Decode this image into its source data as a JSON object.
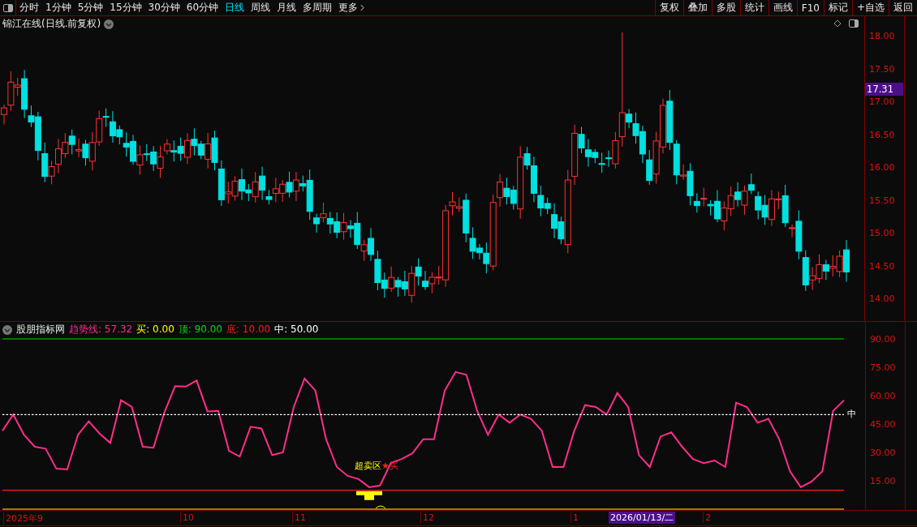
{
  "toolbar": {
    "periods": [
      {
        "label": "分时",
        "selected": false
      },
      {
        "label": "1分钟",
        "selected": false
      },
      {
        "label": "5分钟",
        "selected": false
      },
      {
        "label": "15分钟",
        "selected": false
      },
      {
        "label": "30分钟",
        "selected": false
      },
      {
        "label": "60分钟",
        "selected": false
      },
      {
        "label": "日线",
        "selected": true
      },
      {
        "label": "周线",
        "selected": false
      },
      {
        "label": "月线",
        "selected": false
      },
      {
        "label": "多周期",
        "selected": false
      },
      {
        "label": "更多",
        "selected": false
      }
    ],
    "actions": [
      "复权",
      "叠加",
      "多股",
      "统计",
      "画线",
      "F10",
      "标记",
      "+自选",
      "返回"
    ]
  },
  "main_chart": {
    "title": "锦江在线(日线.前复权)",
    "price_ticks": [
      "18.00",
      "17.50",
      "17.00",
      "16.50",
      "16.00",
      "15.50",
      "15.00",
      "14.50",
      "14.00"
    ],
    "current_price": "17.31"
  },
  "indicator": {
    "name": "股朋指标网",
    "readouts": [
      {
        "label": "趋势线:",
        "value": "57.32",
        "color": "#ff2d8a"
      },
      {
        "label": "买:",
        "value": "0.00",
        "color": "#ffff00"
      },
      {
        "label": "顶:",
        "value": "90.00",
        "color": "#00dd00"
      },
      {
        "label": "底:",
        "value": "10.00",
        "color": "#ff1a1a"
      },
      {
        "label": "中:",
        "value": "50.00",
        "color": "#ffffff"
      }
    ],
    "mid_label": "中",
    "zone_label": "超卖区",
    "signal_label": "★买",
    "chart_data": {
      "type": "line",
      "ylim": [
        0,
        99
      ],
      "yticks": [
        {
          "value": 90,
          "label": "90.00"
        },
        {
          "value": 75,
          "label": "75.00"
        },
        {
          "value": 60,
          "label": "60.00"
        },
        {
          "value": 45,
          "label": "45.00"
        },
        {
          "value": 30,
          "label": "30.00"
        },
        {
          "value": 15,
          "label": "15.00"
        }
      ],
      "series": [
        {
          "color": "#ff2d8a",
          "values": [
            41.4,
            50,
            39.3,
            33,
            32,
            21.4,
            21,
            39.3,
            46.5,
            40,
            35,
            57.6,
            54,
            33,
            32.5,
            51,
            65,
            64.8,
            68,
            51.7,
            52,
            30.8,
            27.8,
            43.6,
            42.7,
            28.6,
            30,
            54,
            69,
            62.7,
            37,
            22.3,
            17.6,
            15.9,
            11.6,
            12.5,
            24.4,
            26.5,
            29.5,
            37,
            37,
            62.7,
            72.5,
            71,
            52,
            39.3,
            50,
            45.7,
            50,
            47.8,
            41.4,
            22.3,
            22.3,
            41.4,
            55,
            54,
            50,
            61.4,
            54,
            28.6,
            22.3,
            38.4,
            40.6,
            33,
            26.5,
            24.4,
            25.7,
            22.3,
            56.3,
            54,
            45.7,
            47.8,
            37,
            20,
            11.6,
            14.6,
            20,
            52,
            57.6
          ]
        },
        {
          "color": "#ffff00",
          "values": [
            0,
            0,
            0,
            0,
            0,
            0,
            0,
            0,
            0,
            0,
            0,
            0,
            0,
            0,
            0,
            0,
            0,
            0,
            0,
            0,
            0,
            0,
            0,
            0,
            0,
            0,
            0,
            0,
            0,
            0,
            0,
            0,
            0,
            0,
            0,
            0,
            0,
            0,
            0,
            0,
            0,
            0,
            0,
            0,
            0,
            0,
            0,
            0,
            0,
            0,
            0,
            0,
            0,
            0,
            0,
            0,
            0,
            0,
            0,
            0,
            0,
            0,
            0,
            0,
            0,
            0,
            0,
            0,
            0,
            0,
            0,
            0,
            0,
            0,
            0,
            0,
            0,
            0,
            0
          ]
        },
        {
          "color": "#00dd00",
          "values": [
            90,
            90,
            90,
            90,
            90,
            90,
            90,
            90,
            90,
            90,
            90,
            90,
            90,
            90,
            90,
            90,
            90,
            90,
            90,
            90,
            90,
            90,
            90,
            90,
            90,
            90,
            90,
            90,
            90,
            90,
            90,
            90,
            90,
            90,
            90,
            90,
            90,
            90,
            90,
            90,
            90,
            90,
            90,
            90,
            90,
            90,
            90,
            90,
            90,
            90,
            90,
            90,
            90,
            90,
            90,
            90,
            90,
            90,
            90,
            90,
            90,
            90,
            90,
            90,
            90,
            90,
            90,
            90,
            90,
            90,
            90,
            90,
            90,
            90,
            90,
            90,
            90,
            90,
            90
          ]
        },
        {
          "color": "#ff1a1a",
          "values": [
            10,
            10,
            10,
            10,
            10,
            10,
            10,
            10,
            10,
            10,
            10,
            10,
            10,
            10,
            10,
            10,
            10,
            10,
            10,
            10,
            10,
            10,
            10,
            10,
            10,
            10,
            10,
            10,
            10,
            10,
            10,
            10,
            10,
            10,
            10,
            10,
            10,
            10,
            10,
            10,
            10,
            10,
            10,
            10,
            10,
            10,
            10,
            10,
            10,
            10,
            10,
            10,
            10,
            10,
            10,
            10,
            10,
            10,
            10,
            10,
            10,
            10,
            10,
            10,
            10,
            10,
            10,
            10,
            10,
            10,
            10,
            10,
            10,
            10,
            10,
            10,
            10,
            10,
            10
          ]
        },
        {
          "color": "#ffffff",
          "line_style": "dotted",
          "values": [
            50,
            50,
            50,
            50,
            50,
            50,
            50,
            50,
            50,
            50,
            50,
            50,
            50,
            50,
            50,
            50,
            50,
            50,
            50,
            50,
            50,
            50,
            50,
            50,
            50,
            50,
            50,
            50,
            50,
            50,
            50,
            50,
            50,
            50,
            50,
            50,
            50,
            50,
            50,
            50,
            50,
            50,
            50,
            50,
            50,
            50,
            50,
            50,
            50,
            50,
            50,
            50,
            50,
            50,
            50,
            50,
            50,
            50,
            50,
            50,
            50,
            50,
            50,
            50,
            50,
            50,
            50,
            50,
            50,
            50,
            50,
            50,
            50,
            50,
            50,
            50,
            50,
            50,
            50
          ]
        }
      ]
    }
  },
  "date_axis": {
    "labels": [
      "2025年9",
      "10",
      "11",
      "12",
      "1",
      "2"
    ],
    "cursor_date": "2026/01/13/二"
  }
}
